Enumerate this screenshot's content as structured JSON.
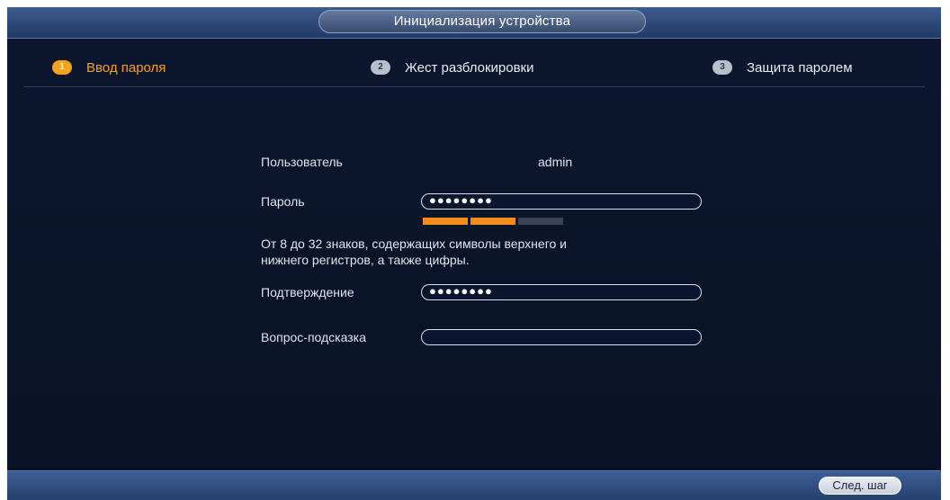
{
  "window": {
    "title": "Инициализация устройства"
  },
  "steps": [
    {
      "number": "1",
      "label": "Ввод пароля",
      "state": "active"
    },
    {
      "number": "2",
      "label": "Жест разблокировки",
      "state": "inactive"
    },
    {
      "number": "3",
      "label": "Защита паролем",
      "state": "inactive"
    }
  ],
  "form": {
    "user_label": "Пользователь",
    "user_value": "admin",
    "password_label": "Пароль",
    "password_value": "●●●●●●●●",
    "strength": {
      "level": 0.67,
      "segments": [
        "filled",
        "filled",
        "empty"
      ],
      "filled_color": "#f18f1c",
      "empty_color": "#3a4258"
    },
    "hint_text": "От 8 до 32 знаков, содержащих символы верхнего и\n нижнего регистров, а также цифры.",
    "confirm_label": "Подтверждение",
    "confirm_value": "●●●●●●●●",
    "question_label": "Вопрос-подсказка",
    "question_value": ""
  },
  "footer": {
    "next_label": "След. шаг"
  },
  "colors": {
    "accent": "#f6a21a",
    "background": "#0b1630"
  }
}
